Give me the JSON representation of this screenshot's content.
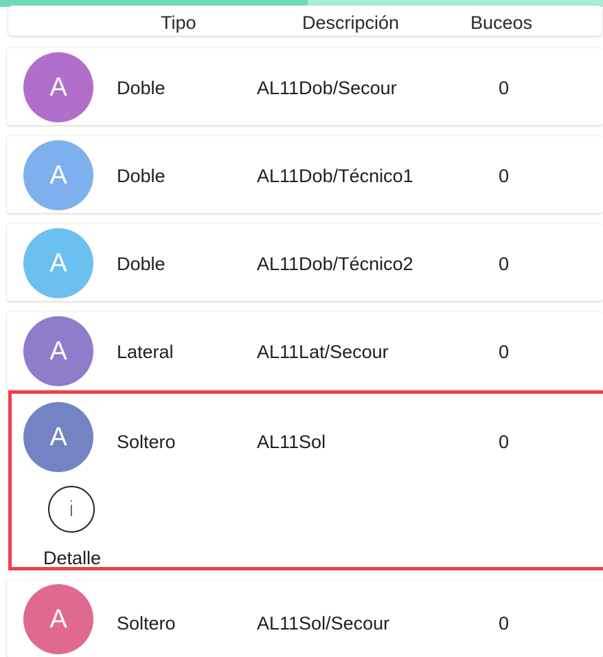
{
  "progress": {
    "fraction": 0.51,
    "fill_color": "#6cdcb6",
    "track_color": "#a6ecd6"
  },
  "header": {
    "col_tipo": "Tipo",
    "col_descripcion": "Descripción",
    "col_buceos": "Buceos"
  },
  "rows": [
    {
      "avatar": "A",
      "avatar_color": "#b26ecb",
      "tipo": "Doble",
      "descripcion": "AL11Dob/Secour",
      "buceos": "0"
    },
    {
      "avatar": "A",
      "avatar_color": "#7eb0ee",
      "tipo": "Doble",
      "descripcion": "AL11Dob/Técnico1",
      "buceos": "0"
    },
    {
      "avatar": "A",
      "avatar_color": "#6cc0f0",
      "tipo": "Doble",
      "descripcion": "AL11Dob/Técnico2",
      "buceos": "0"
    },
    {
      "avatar": "A",
      "avatar_color": "#8f7ccb",
      "tipo": "Lateral",
      "descripcion": "AL11Lat/Secour",
      "buceos": "0"
    },
    {
      "avatar": "A",
      "avatar_color": "#7483c4",
      "tipo": "Soltero",
      "descripcion": "AL11Sol",
      "buceos": "0",
      "detail_icon": "info-icon",
      "detail_icon_glyph": "i",
      "detail_label": "Detalle"
    },
    {
      "avatar": "A",
      "avatar_color": "#e06a8e",
      "tipo": "Soltero",
      "descripcion": "AL11Sol/Secour",
      "buceos": "0"
    }
  ],
  "selection_color": "#ee4149"
}
